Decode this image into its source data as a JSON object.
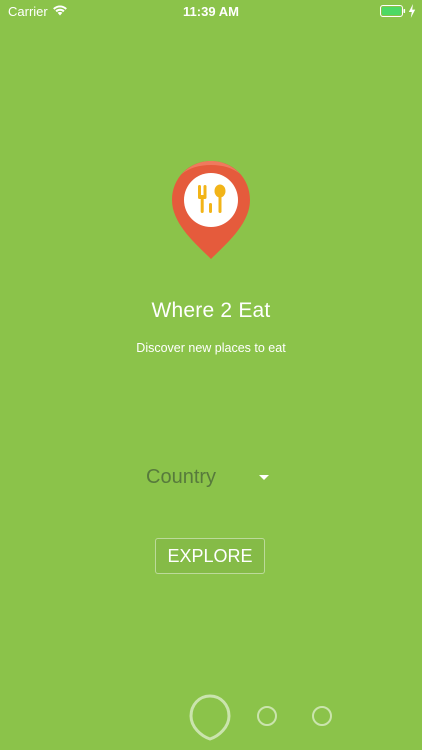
{
  "status_bar": {
    "carrier": "Carrier",
    "time": "11:39 AM",
    "battery_color": "#4cd964"
  },
  "app": {
    "title": "Where 2 Eat",
    "subtitle": "Discover new places to eat",
    "logo_icon": "map-pin-fork-spoon-icon",
    "logo_color": "#e55b3c",
    "background_color": "#8bc34a"
  },
  "country_select": {
    "label": "Country"
  },
  "explore_button": {
    "label": "EXPLORE"
  },
  "pager": {
    "pages": 3,
    "active_index": 0
  }
}
